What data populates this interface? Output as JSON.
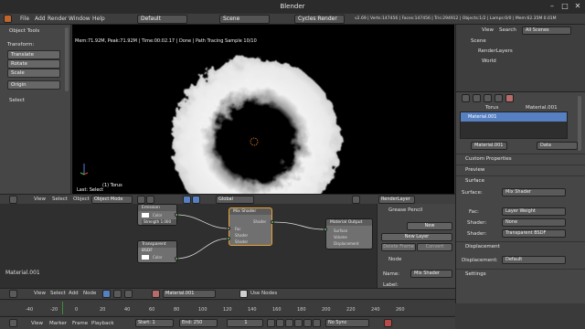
{
  "window": {
    "title": "Blender"
  },
  "menu": {
    "items": [
      "File",
      "Add",
      "Render",
      "Window",
      "Help"
    ],
    "screen_layout": "Default",
    "scene": "Scene",
    "render_engine": "Cycles Render",
    "stats": "v2.69 | Verts:147456 | Faces:147456 | Tris:294912 | Objects:1/2 | Lamps:0/0 | Mem:62.35M 0.01M"
  },
  "toolshelf": {
    "panel_title": "Object Tools",
    "transform_label": "Transform:",
    "buttons": [
      "Translate",
      "Rotate",
      "Scale"
    ],
    "origin_button": "Origin",
    "select_panel": "Select"
  },
  "viewport": {
    "info": "Mem:71.92M, Peak:71.92M | Time:00:02.17 | Done | Path Tracing Sample 10/10",
    "object_name": "(1) Torus",
    "last_op": "Last: Select"
  },
  "view3d_header": {
    "items": [
      "View",
      "Select",
      "Object"
    ],
    "mode": "Object Mode",
    "orientation": "Global",
    "layer": "RenderLayer"
  },
  "outliner": {
    "view": "View",
    "search": "Search",
    "filter": "All Scenes",
    "tree": [
      "Scene",
      "RenderLayers",
      "World"
    ]
  },
  "properties": {
    "breadcrumb": [
      "Torus",
      "Material.001"
    ],
    "slot": "Material.001",
    "material_name": "Material.001",
    "data_mode": "Data",
    "sections": [
      "Custom Properties",
      "Preview",
      "Surface"
    ],
    "surface_label": "Surface:",
    "surface_value": "Mix Shader",
    "fac_label": "Fac:",
    "fac_value": "Layer Weight",
    "shader1_label": "Shader:",
    "shader1_value": "None",
    "shader2_label": "Shader:",
    "shader2_value": "Transparent BSDF",
    "displacement_section": "Displacement",
    "displacement_label": "Displacement:",
    "displacement_value": "Default",
    "settings_section": "Settings"
  },
  "node_editor": {
    "material_label": "Material.001",
    "nodes": {
      "emission": {
        "title": "Emission",
        "color": "Color",
        "strength": "Strength 1.000"
      },
      "transparent": {
        "title": "Transparent BSDF",
        "color": "Color"
      },
      "mix": {
        "title": "Mix Shader",
        "out": "Shader",
        "fac": "Fac",
        "shader1": "Shader",
        "shader2": "Shader"
      },
      "output": {
        "title": "Material Output",
        "surface": "Surface",
        "volume": "Volume",
        "displacement": "Displacement"
      }
    }
  },
  "grease_pencil": {
    "title": "Grease Pencil",
    "new": "New",
    "new_layer": "New Layer",
    "delete_frame": "Delete Frame",
    "convert": "Convert",
    "node_panel": "Node",
    "name_label": "Name:",
    "name_value": "Mix Shader",
    "label_label": "Label:"
  },
  "node_header": {
    "items": [
      "View",
      "Select",
      "Add",
      "Node"
    ],
    "material": "Material.001",
    "use_nodes": "Use Nodes"
  },
  "timeline": {
    "ticks": [
      "-40",
      "-20",
      "0",
      "20",
      "40",
      "60",
      "80",
      "100",
      "120",
      "140",
      "160",
      "180",
      "200",
      "220",
      "240",
      "260"
    ],
    "items": [
      "View",
      "Marker",
      "Frame",
      "Playback"
    ],
    "start": "Start: 1",
    "end": "End: 250",
    "current": "1",
    "sync": "No Sync"
  }
}
